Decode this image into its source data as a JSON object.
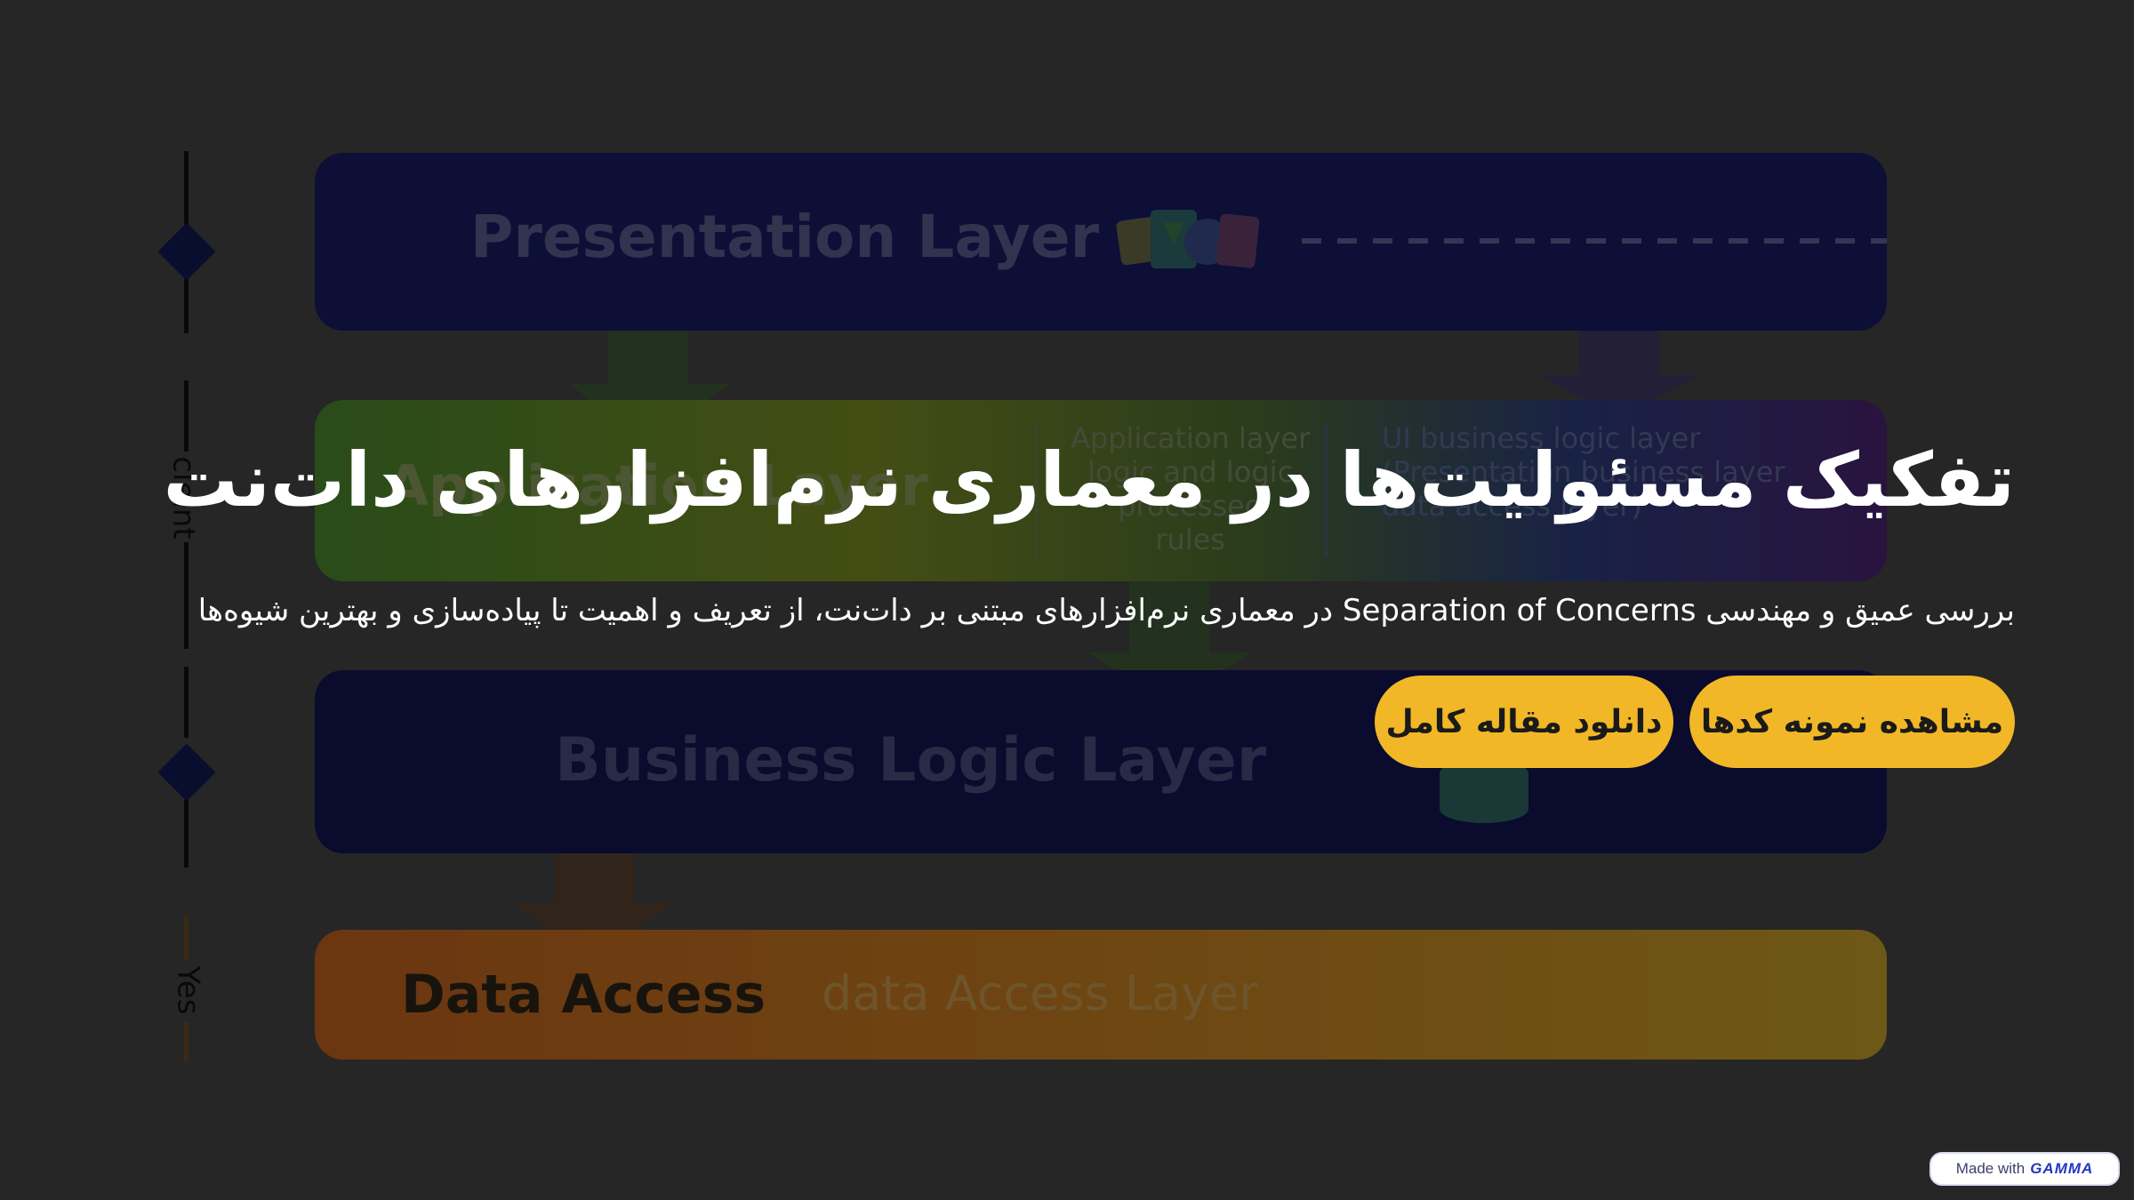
{
  "hero": {
    "title": "تفکیک مسئولیت‌ها در معماری نرم‌افزارهای دات‌نت",
    "subtitle": "بررسی عمیق و مهندسی Separation of Concerns در معماری نرم‌افزارهای مبتنی بر دات‌نت، از تعریف و اهمیت تا پیاده‌سازی و بهترین شیوه‌ها"
  },
  "buttons": {
    "view_code": "مشاهده نمونه کدها",
    "download_article": "دانلود مقاله کامل"
  },
  "badge": {
    "prefix": "Made with",
    "brand": "GAMMA"
  },
  "diagram": {
    "presentation_layer": "Presentation Layer",
    "application_layer": "Application Layer",
    "application_col1": [
      "Application layer",
      "logic and logic",
      "processed",
      "rules"
    ],
    "application_col2": [
      "UI business logic layer",
      "(Presentation business layer",
      "data access layer)"
    ],
    "business_layer": "Business Logic Layer",
    "data_access": "Data Access",
    "data_access_sub": "data Access Layer",
    "timeline_label_client": "cleint",
    "timeline_label_yes": "Yes"
  },
  "colors": {
    "background": "#353535",
    "button": "#f1b727",
    "title_text": "#ffffff",
    "badge_brand": "#2437c4"
  }
}
